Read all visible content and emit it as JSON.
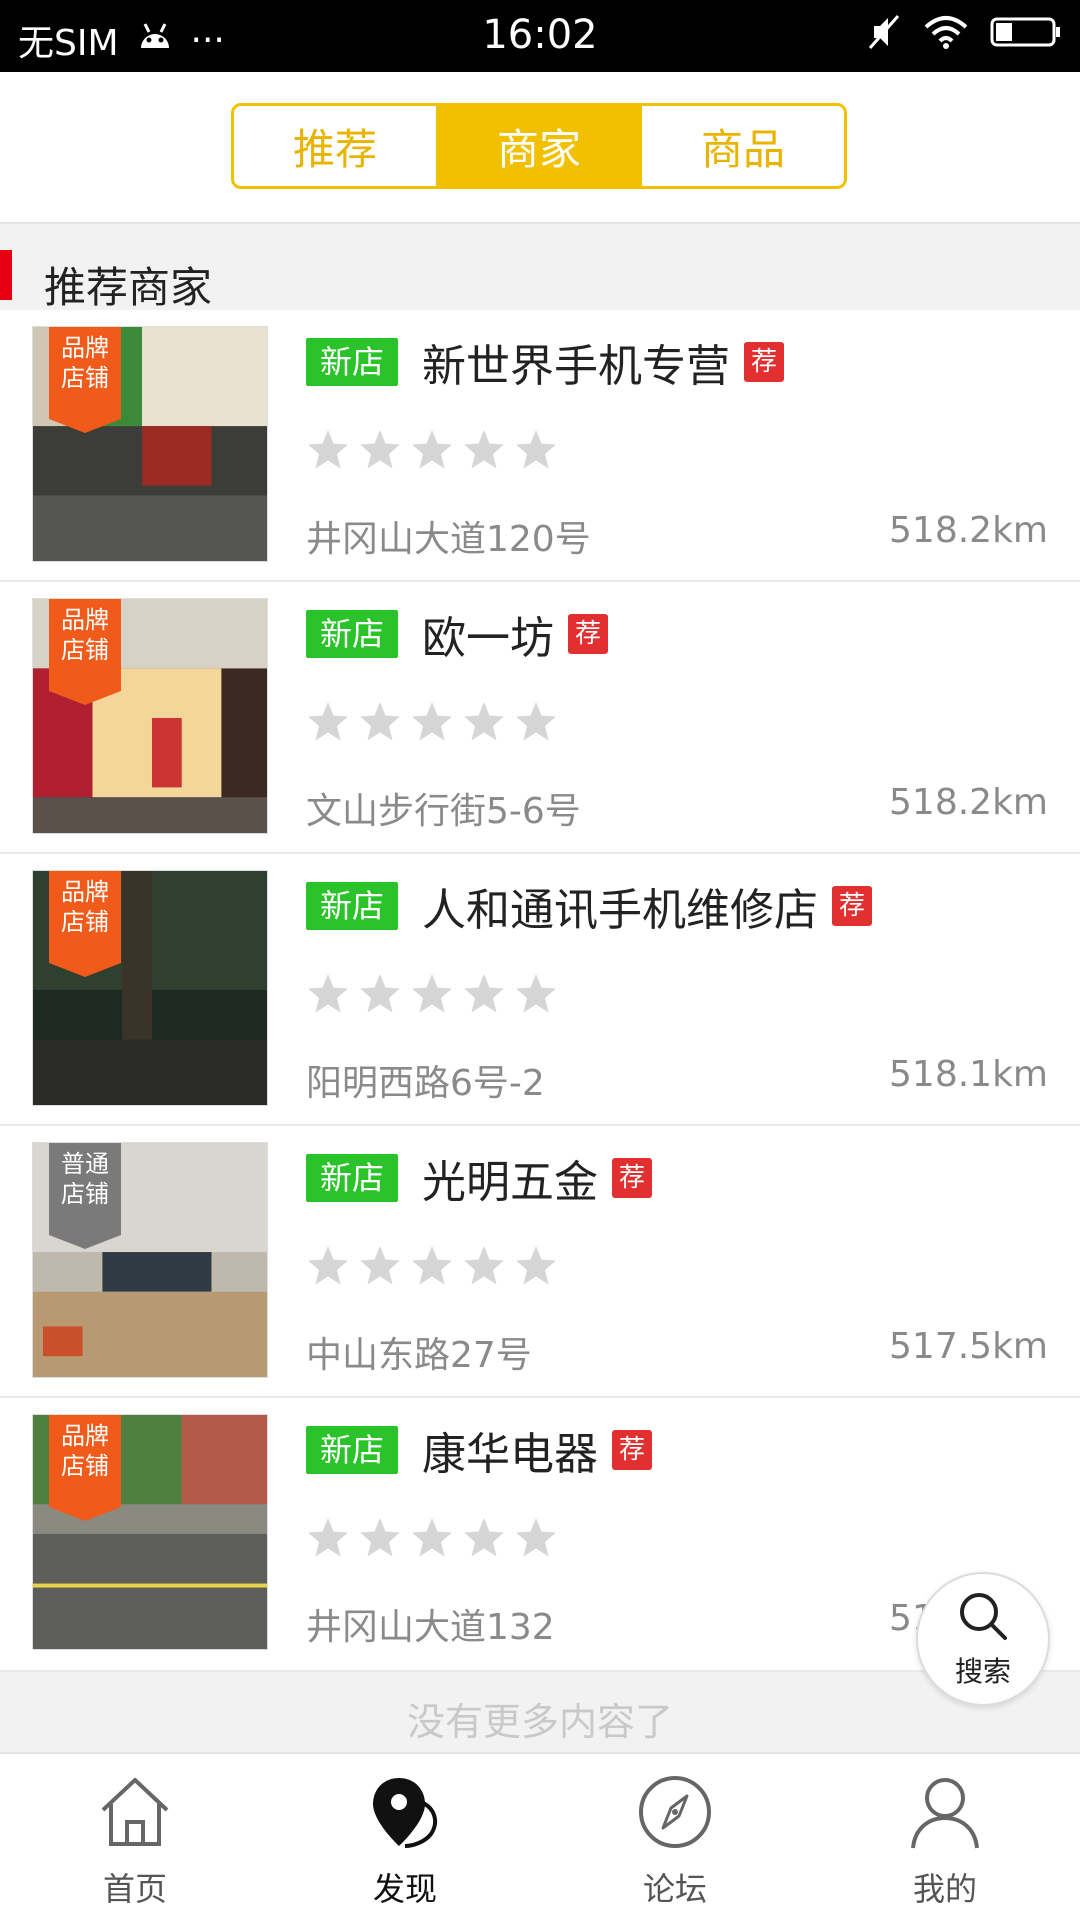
{
  "status_bar": {
    "carrier": "无SIM",
    "dots": "···",
    "time": "16:02"
  },
  "segments": [
    {
      "label": "推荐",
      "active": false
    },
    {
      "label": "商家",
      "active": true
    },
    {
      "label": "商品",
      "active": false
    }
  ],
  "section": {
    "title": "推荐商家"
  },
  "tags": {
    "new": "新店",
    "rec": "荐"
  },
  "shops": [
    {
      "badge": "品牌\n店铺",
      "badge_color": "#f05a1a",
      "name": "新世界手机专营",
      "rating": 0,
      "address": "井冈山大道120号",
      "distance": "518.2km"
    },
    {
      "badge": "品牌\n店铺",
      "badge_color": "#f05a1a",
      "name": "欧一坊",
      "rating": 0,
      "address": "文山步行街5-6号",
      "distance": "518.2km"
    },
    {
      "badge": "品牌\n店铺",
      "badge_color": "#f05a1a",
      "name": "人和通讯手机维修店",
      "rating": 0,
      "address": "阳明西路6号-2",
      "distance": "518.1km"
    },
    {
      "badge": "普通\n店铺",
      "badge_color": "#7a7a7a",
      "name": "光明五金",
      "rating": 0,
      "address": "中山东路27号",
      "distance": "517.5km"
    },
    {
      "badge": "品牌\n店铺",
      "badge_color": "#f05a1a",
      "name": "康华电器",
      "rating": 0,
      "address": "井冈山大道132",
      "distance": "518.8km"
    }
  ],
  "end_note": "没有更多内容了",
  "search_fab": {
    "label": "搜索"
  },
  "nav": [
    {
      "label": "首页",
      "icon": "home-icon",
      "active": false
    },
    {
      "label": "发现",
      "icon": "discover-pin-icon",
      "active": true
    },
    {
      "label": "论坛",
      "icon": "compass-icon",
      "active": false
    },
    {
      "label": "我的",
      "icon": "user-icon",
      "active": false
    }
  ],
  "colors": {
    "accent": "#f1c000",
    "new_tag": "#2ac42a",
    "rec_tag": "#e23030",
    "section_bar": "#e60012"
  }
}
